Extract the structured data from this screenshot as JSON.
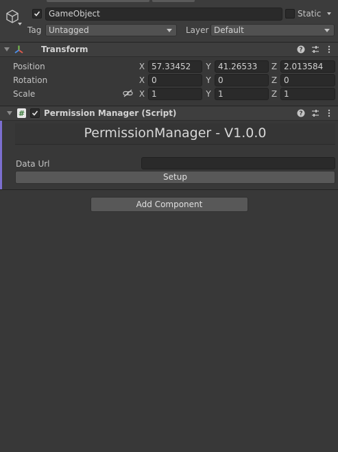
{
  "gameobject": {
    "active_checked": true,
    "name": "GameObject",
    "static_label": "Static",
    "static_checked": false,
    "tag_label": "Tag",
    "tag_value": "Untagged",
    "layer_label": "Layer",
    "layer_value": "Default"
  },
  "transform": {
    "title": "Transform",
    "rows": [
      {
        "label": "Position",
        "x": "57.33452",
        "y": "41.26533",
        "z": "2.013584"
      },
      {
        "label": "Rotation",
        "x": "0",
        "y": "0",
        "z": "0"
      },
      {
        "label": "Scale",
        "x": "1",
        "y": "1",
        "z": "1"
      }
    ],
    "axis": {
      "x": "X",
      "y": "Y",
      "z": "Z"
    }
  },
  "script_component": {
    "title": "Permission Manager (Script)",
    "enabled_checked": true,
    "banner": "PermissionManager - V1.0.0",
    "data_url_label": "Data Url",
    "data_url_value": "",
    "setup_label": "Setup"
  },
  "add_component_label": "Add Component",
  "icons": {
    "gameobject": "cube-icon",
    "transform": "transform-axes-icon",
    "script": "csharp-script-icon",
    "help": "help-icon",
    "presets": "presets-icon",
    "menu": "kebab-menu-icon",
    "constrain": "constrain-proportions-icon"
  },
  "colors": {
    "background": "#383838",
    "field": "#2a2a2a",
    "button": "#585858",
    "accent": "#7c6fd0"
  }
}
